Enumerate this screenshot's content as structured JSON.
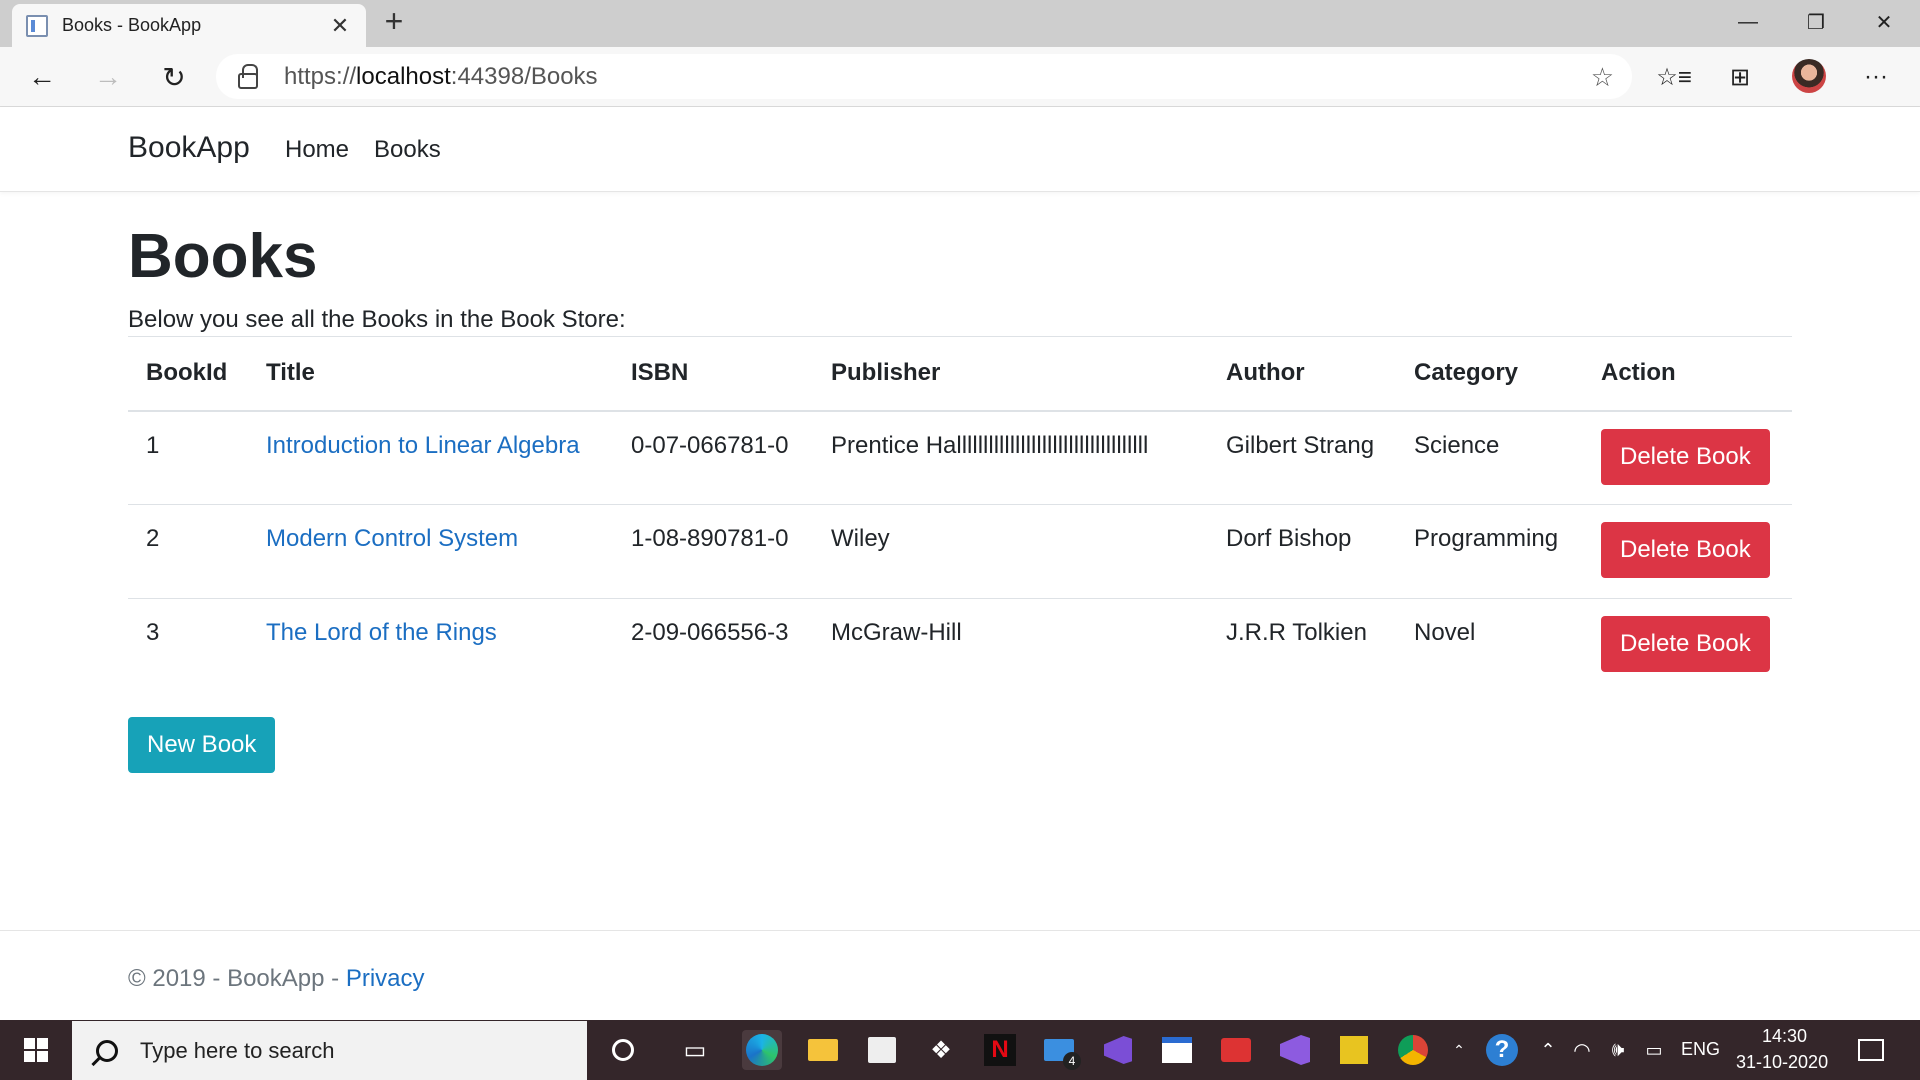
{
  "browser": {
    "tab_title": "Books - BookApp",
    "tab_close": "✕",
    "new_tab": "+",
    "url_scheme": "https://",
    "url_host": "localhost",
    "url_path": ":44398/Books",
    "window": {
      "minimize": "—",
      "restore": "❐",
      "close": "✕"
    },
    "nav": {
      "back": "←",
      "forward": "→",
      "refresh": "↻"
    },
    "tools": {
      "favorite": "☆",
      "favorites": "☆≡",
      "collections": "⊞",
      "more": "···"
    }
  },
  "site": {
    "brand": "BookApp",
    "nav": [
      {
        "label": "Home"
      },
      {
        "label": "Books"
      }
    ]
  },
  "page": {
    "title": "Books",
    "subtitle": "Below you see all the Books in the Book Store:",
    "table": {
      "headers": [
        "BookId",
        "Title",
        "ISBN",
        "Publisher",
        "Author",
        "Category",
        "Action"
      ],
      "rows": [
        {
          "id": "1",
          "title": "Introduction to Linear Algebra",
          "isbn": "0-07-066781-0",
          "publisher": "Prentice Hallllllllllllllllllllllllllllllllllll",
          "author": "Gilbert Strang",
          "category": "Science",
          "action": "Delete Book"
        },
        {
          "id": "2",
          "title": "Modern Control System",
          "isbn": "1-08-890781-0",
          "publisher": "Wiley",
          "author": "Dorf Bishop",
          "category": "Programming",
          "action": "Delete Book"
        },
        {
          "id": "3",
          "title": "The Lord of the Rings",
          "isbn": "2-09-066556-3",
          "publisher": "McGraw-Hill",
          "author": "J.R.R Tolkien",
          "category": "Novel",
          "action": "Delete Book"
        }
      ]
    },
    "new_book_label": "New Book"
  },
  "footer": {
    "text": "© 2019 - BookApp - ",
    "privacy": "Privacy"
  },
  "taskbar": {
    "search_placeholder": "Type here to search",
    "mail_badge": "4",
    "language": "ENG",
    "time": "14:30",
    "date": "31-10-2020"
  },
  "colors": {
    "danger": "#dc3545",
    "info": "#17a2b8",
    "link": "#1b6ec2",
    "taskbar": "#34262a"
  }
}
